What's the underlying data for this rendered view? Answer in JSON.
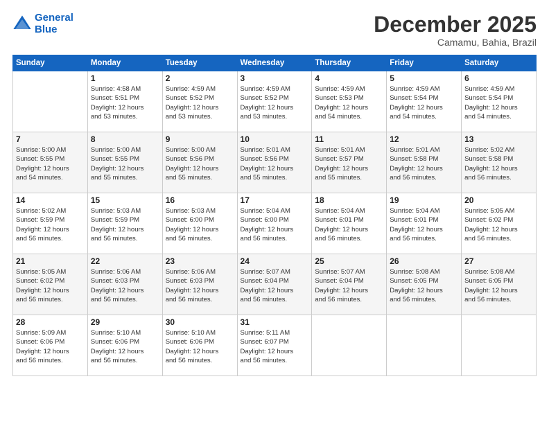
{
  "header": {
    "logo_line1": "General",
    "logo_line2": "Blue",
    "month": "December 2025",
    "location": "Camamu, Bahia, Brazil"
  },
  "weekdays": [
    "Sunday",
    "Monday",
    "Tuesday",
    "Wednesday",
    "Thursday",
    "Friday",
    "Saturday"
  ],
  "weeks": [
    [
      {
        "day": "",
        "info": ""
      },
      {
        "day": "1",
        "info": "Sunrise: 4:58 AM\nSunset: 5:51 PM\nDaylight: 12 hours\nand 53 minutes."
      },
      {
        "day": "2",
        "info": "Sunrise: 4:59 AM\nSunset: 5:52 PM\nDaylight: 12 hours\nand 53 minutes."
      },
      {
        "day": "3",
        "info": "Sunrise: 4:59 AM\nSunset: 5:52 PM\nDaylight: 12 hours\nand 53 minutes."
      },
      {
        "day": "4",
        "info": "Sunrise: 4:59 AM\nSunset: 5:53 PM\nDaylight: 12 hours\nand 54 minutes."
      },
      {
        "day": "5",
        "info": "Sunrise: 4:59 AM\nSunset: 5:54 PM\nDaylight: 12 hours\nand 54 minutes."
      },
      {
        "day": "6",
        "info": "Sunrise: 4:59 AM\nSunset: 5:54 PM\nDaylight: 12 hours\nand 54 minutes."
      }
    ],
    [
      {
        "day": "7",
        "info": "Sunrise: 5:00 AM\nSunset: 5:55 PM\nDaylight: 12 hours\nand 54 minutes."
      },
      {
        "day": "8",
        "info": "Sunrise: 5:00 AM\nSunset: 5:55 PM\nDaylight: 12 hours\nand 55 minutes."
      },
      {
        "day": "9",
        "info": "Sunrise: 5:00 AM\nSunset: 5:56 PM\nDaylight: 12 hours\nand 55 minutes."
      },
      {
        "day": "10",
        "info": "Sunrise: 5:01 AM\nSunset: 5:56 PM\nDaylight: 12 hours\nand 55 minutes."
      },
      {
        "day": "11",
        "info": "Sunrise: 5:01 AM\nSunset: 5:57 PM\nDaylight: 12 hours\nand 55 minutes."
      },
      {
        "day": "12",
        "info": "Sunrise: 5:01 AM\nSunset: 5:58 PM\nDaylight: 12 hours\nand 56 minutes."
      },
      {
        "day": "13",
        "info": "Sunrise: 5:02 AM\nSunset: 5:58 PM\nDaylight: 12 hours\nand 56 minutes."
      }
    ],
    [
      {
        "day": "14",
        "info": "Sunrise: 5:02 AM\nSunset: 5:59 PM\nDaylight: 12 hours\nand 56 minutes."
      },
      {
        "day": "15",
        "info": "Sunrise: 5:03 AM\nSunset: 5:59 PM\nDaylight: 12 hours\nand 56 minutes."
      },
      {
        "day": "16",
        "info": "Sunrise: 5:03 AM\nSunset: 6:00 PM\nDaylight: 12 hours\nand 56 minutes."
      },
      {
        "day": "17",
        "info": "Sunrise: 5:04 AM\nSunset: 6:00 PM\nDaylight: 12 hours\nand 56 minutes."
      },
      {
        "day": "18",
        "info": "Sunrise: 5:04 AM\nSunset: 6:01 PM\nDaylight: 12 hours\nand 56 minutes."
      },
      {
        "day": "19",
        "info": "Sunrise: 5:04 AM\nSunset: 6:01 PM\nDaylight: 12 hours\nand 56 minutes."
      },
      {
        "day": "20",
        "info": "Sunrise: 5:05 AM\nSunset: 6:02 PM\nDaylight: 12 hours\nand 56 minutes."
      }
    ],
    [
      {
        "day": "21",
        "info": "Sunrise: 5:05 AM\nSunset: 6:02 PM\nDaylight: 12 hours\nand 56 minutes."
      },
      {
        "day": "22",
        "info": "Sunrise: 5:06 AM\nSunset: 6:03 PM\nDaylight: 12 hours\nand 56 minutes."
      },
      {
        "day": "23",
        "info": "Sunrise: 5:06 AM\nSunset: 6:03 PM\nDaylight: 12 hours\nand 56 minutes."
      },
      {
        "day": "24",
        "info": "Sunrise: 5:07 AM\nSunset: 6:04 PM\nDaylight: 12 hours\nand 56 minutes."
      },
      {
        "day": "25",
        "info": "Sunrise: 5:07 AM\nSunset: 6:04 PM\nDaylight: 12 hours\nand 56 minutes."
      },
      {
        "day": "26",
        "info": "Sunrise: 5:08 AM\nSunset: 6:05 PM\nDaylight: 12 hours\nand 56 minutes."
      },
      {
        "day": "27",
        "info": "Sunrise: 5:08 AM\nSunset: 6:05 PM\nDaylight: 12 hours\nand 56 minutes."
      }
    ],
    [
      {
        "day": "28",
        "info": "Sunrise: 5:09 AM\nSunset: 6:06 PM\nDaylight: 12 hours\nand 56 minutes."
      },
      {
        "day": "29",
        "info": "Sunrise: 5:10 AM\nSunset: 6:06 PM\nDaylight: 12 hours\nand 56 minutes."
      },
      {
        "day": "30",
        "info": "Sunrise: 5:10 AM\nSunset: 6:06 PM\nDaylight: 12 hours\nand 56 minutes."
      },
      {
        "day": "31",
        "info": "Sunrise: 5:11 AM\nSunset: 6:07 PM\nDaylight: 12 hours\nand 56 minutes."
      },
      {
        "day": "",
        "info": ""
      },
      {
        "day": "",
        "info": ""
      },
      {
        "day": "",
        "info": ""
      }
    ]
  ]
}
